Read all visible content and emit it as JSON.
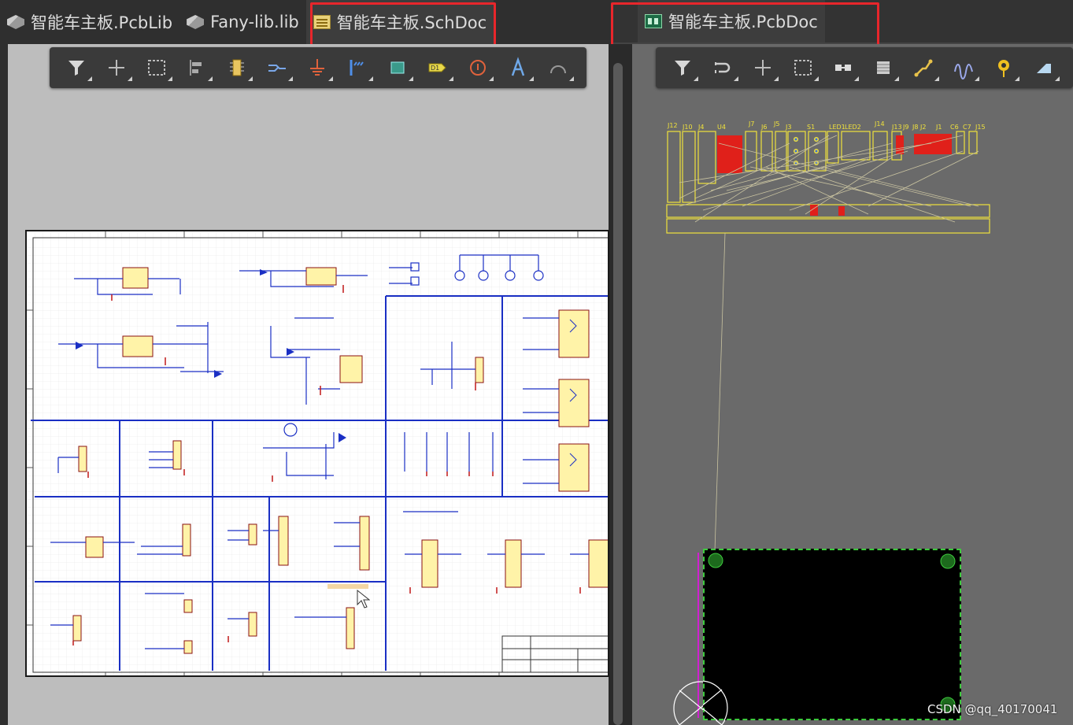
{
  "tabs_left": [
    {
      "label": "智能车主板.PcbLib",
      "icon": "pcblib-icon",
      "active": false
    },
    {
      "label": "Fany-lib.lib",
      "icon": "schlib-icon",
      "active": false
    },
    {
      "label": "智能车主板.SchDoc",
      "icon": "schdoc-icon",
      "active": true
    }
  ],
  "tabs_right": [
    {
      "label": "智能车主板.PcbDoc",
      "icon": "pcbdoc-icon",
      "active": true
    }
  ],
  "highlight_color": "#e8262b",
  "sch_toolbar": [
    "filter-icon",
    "place-cross-icon",
    "select-rect-icon",
    "align-icon",
    "place-part-icon",
    "place-wire-icon",
    "power-port-icon",
    "place-bus-icon",
    "place-harness-icon",
    "net-label-icon",
    "place-parameter-icon",
    "place-text-icon",
    "place-arc-icon"
  ],
  "pcb_toolbar": [
    "filter-icon",
    "route-interactive-icon",
    "place-cross-icon",
    "select-rect-icon",
    "align-icon",
    "place-component-icon",
    "route-trace-icon",
    "length-tune-icon",
    "place-via-icon",
    "place-fill-icon"
  ],
  "pcb_labels": [
    "J12",
    "J10",
    "J4",
    "U4",
    "J7",
    "J6",
    "J5",
    "J3",
    "S1",
    "LED1",
    "LED2",
    "J14",
    "J13",
    "J9",
    "J8",
    "J2",
    "J1",
    "C6",
    "C7",
    "J15"
  ],
  "watermark": "CSDN @qq_40170041",
  "colors": {
    "schematic_wire": "#1a2fc4",
    "component_fill": "#fff3a8",
    "pcb_silkscreen": "#f0e23c",
    "pcb_ratsnest": "#c9c3a0",
    "pcb_board_outline": "#3ecb3e"
  }
}
